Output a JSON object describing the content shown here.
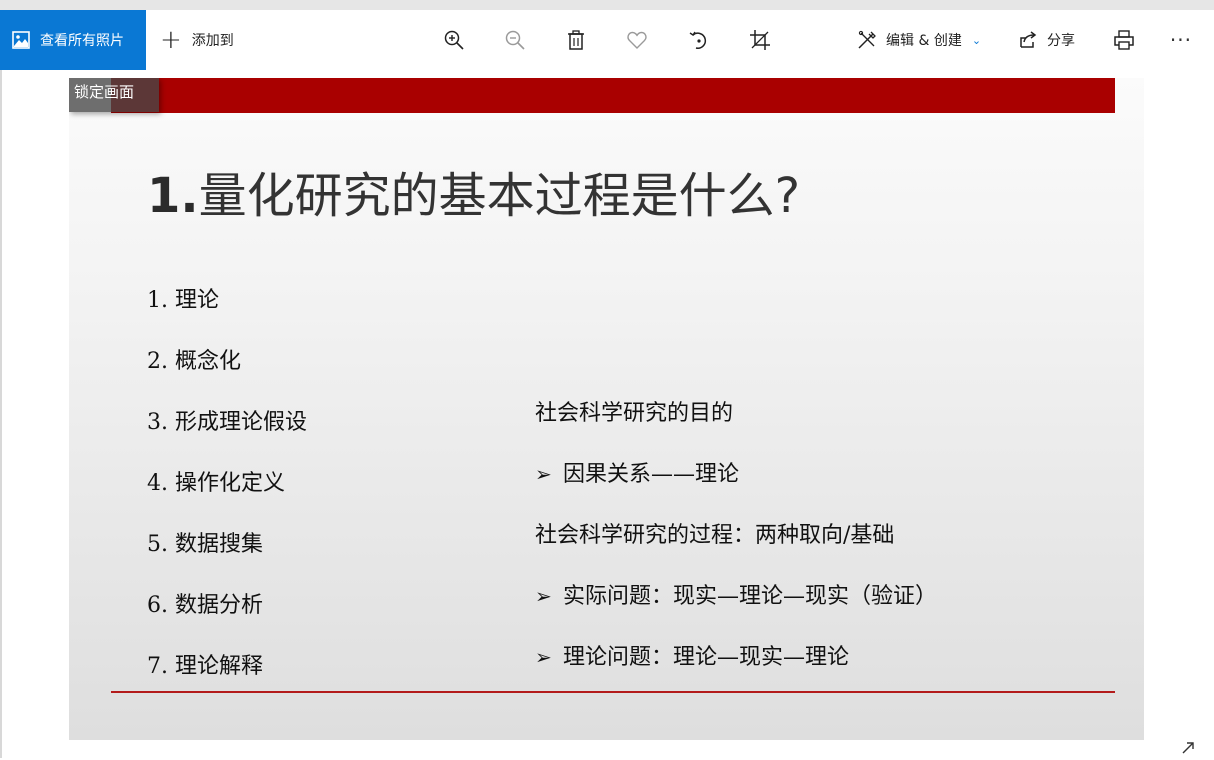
{
  "toolbar": {
    "view_all": "查看所有照片",
    "add_to": "添加到",
    "edit_create": "编辑 & 创建",
    "share": "分享",
    "more": "···"
  },
  "overlay": {
    "lock_label": "锁定画面"
  },
  "slide": {
    "title_num": "1.",
    "title_text": "量化研究的基本过程是什么?",
    "left_items": [
      "1. 理论",
      "2. 概念化",
      "3. 形成理论假设",
      "4. 操作化定义",
      "5. 数据搜集",
      "6. 数据分析",
      "7. 理论解释"
    ],
    "right_lines": [
      {
        "bullet": "",
        "text": "社会科学研究的目的"
      },
      {
        "bullet": "➢",
        "text": "因果关系——理论"
      },
      {
        "bullet": "",
        "text": "社会科学研究的过程：两种取向/基础"
      },
      {
        "bullet": "➢",
        "text": "实际问题：现实—理论—现实（验证）"
      },
      {
        "bullet": "➢",
        "text": "理论问题：理论—现实—理论"
      }
    ]
  },
  "colors": {
    "accent": "#0a78d4",
    "slide_red": "#a90000"
  },
  "icons": [
    "photos-icon",
    "plus-icon",
    "zoom-in-icon",
    "zoom-out-icon",
    "trash-icon",
    "heart-icon",
    "rotate-icon",
    "crop-icon",
    "edit-create-icon",
    "chevron-down-icon",
    "share-icon",
    "print-icon",
    "more-icon",
    "expand-icon"
  ]
}
